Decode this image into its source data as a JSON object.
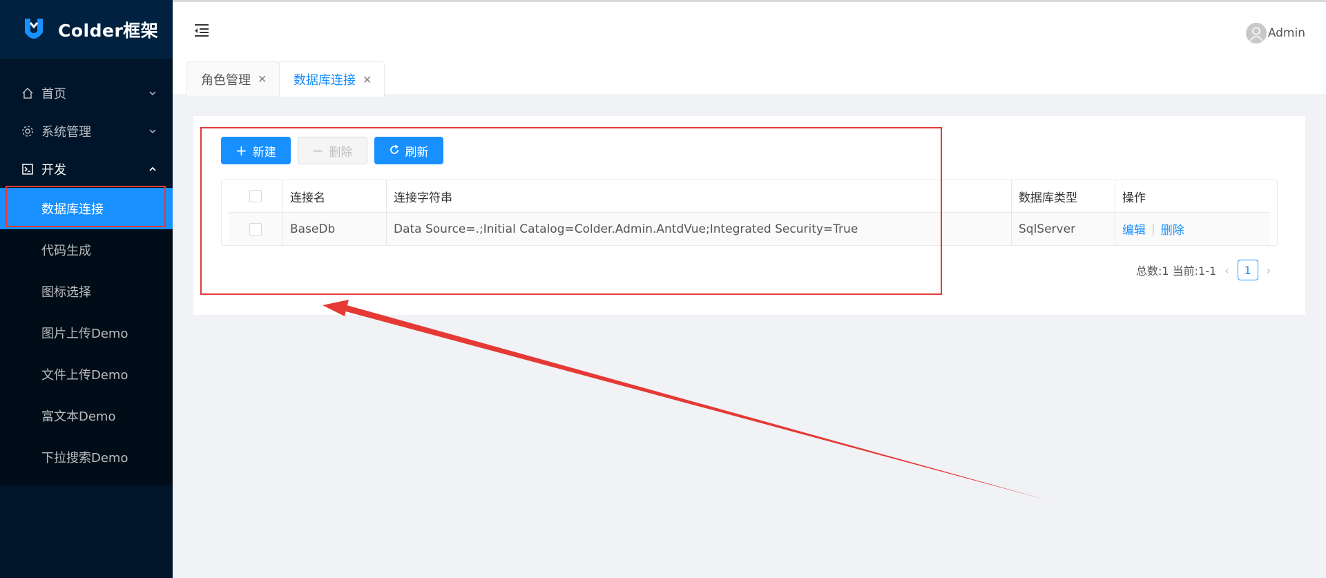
{
  "app": {
    "logo_text": "Colder框架"
  },
  "sidebar": {
    "items": [
      {
        "label": "首页"
      },
      {
        "label": "系统管理"
      },
      {
        "label": "开发"
      }
    ],
    "dev_children": [
      {
        "label": "数据库连接"
      },
      {
        "label": "代码生成"
      },
      {
        "label": "图标选择"
      },
      {
        "label": "图片上传Demo"
      },
      {
        "label": "文件上传Demo"
      },
      {
        "label": "富文本Demo"
      },
      {
        "label": "下拉搜索Demo"
      }
    ]
  },
  "header": {
    "user_name": "Admin"
  },
  "tabs": [
    {
      "label": "角色管理"
    },
    {
      "label": "数据库连接"
    }
  ],
  "toolbar": {
    "new_label": "新建",
    "delete_label": "删除",
    "refresh_label": "刷新"
  },
  "table": {
    "columns": [
      "连接名",
      "连接字符串",
      "数据库类型",
      "操作"
    ],
    "rows": [
      {
        "name": "BaseDb",
        "conn": "Data Source=.;Initial Catalog=Colder.Admin.AntdVue;Integrated Security=True",
        "type": "SqlServer",
        "edit": "编辑",
        "delete": "删除"
      }
    ]
  },
  "pagination": {
    "summary": "总数:1 当前:1-1",
    "current_page": "1"
  },
  "colors": {
    "primary": "#1890ff",
    "sidebar_bg": "#001529",
    "annotation": "#e53935"
  }
}
